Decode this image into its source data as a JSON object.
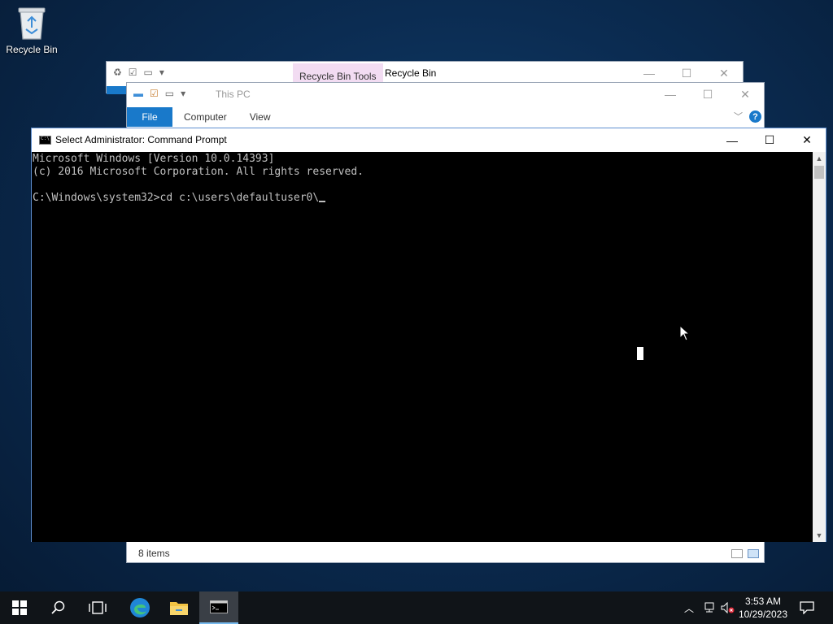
{
  "desktop": {
    "recycle_bin_label": "Recycle Bin"
  },
  "recycle_bin_window": {
    "tools_tab": "Recycle Bin Tools",
    "title": "Recycle Bin",
    "file_tab_partial": "F"
  },
  "this_pc_window": {
    "title": "This PC",
    "tabs": {
      "file": "File",
      "computer": "Computer",
      "view": "View"
    },
    "help_glyph": "?",
    "status_text": "8 items"
  },
  "cmd_window": {
    "title": "Select Administrator: Command Prompt",
    "lines": [
      "Microsoft Windows [Version 10.0.14393]",
      "(c) 2016 Microsoft Corporation. All rights reserved.",
      "",
      "C:\\Windows\\system32>cd c:\\users\\defaultuser0\\"
    ]
  },
  "taskbar": {
    "items": [
      "start-button",
      "search-button",
      "task-view-button",
      "edge-button",
      "file-explorer-button",
      "command-prompt-button"
    ],
    "active_item": "command-prompt-button"
  },
  "clock": {
    "time": "3:53 AM",
    "date": "10/29/2023"
  },
  "colors": {
    "accent": "#1979ca",
    "console_bg": "#000000",
    "console_text": "#c0c0c0",
    "taskbar": "#101418"
  }
}
